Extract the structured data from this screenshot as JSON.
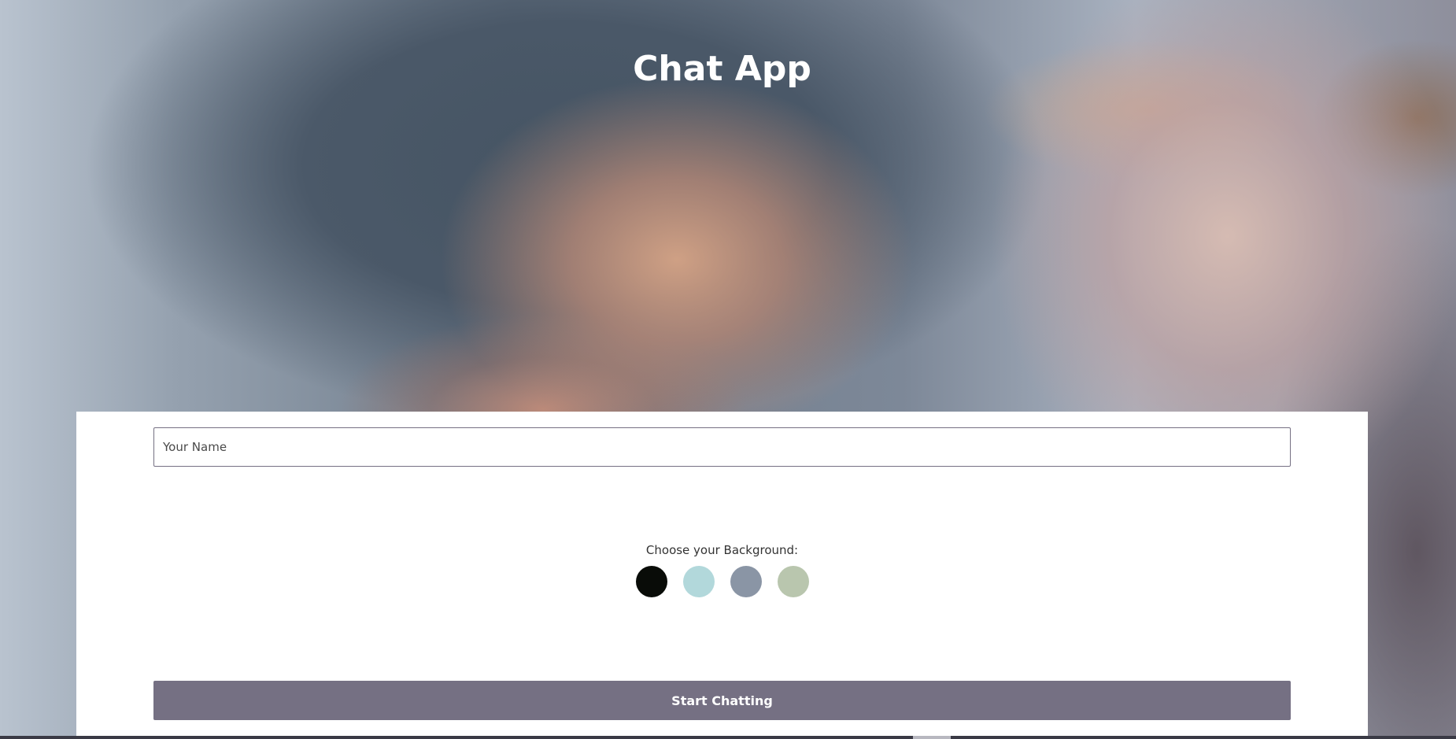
{
  "app": {
    "title": "Chat App"
  },
  "form": {
    "name_placeholder": "Your Name",
    "name_value": "",
    "background_label": "Choose your Background:",
    "background_options": [
      {
        "name": "black",
        "color": "#090C08"
      },
      {
        "name": "light-teal",
        "color": "#B2D8DB"
      },
      {
        "name": "slate-grey",
        "color": "#8A95A5"
      },
      {
        "name": "sage-green",
        "color": "#B9C6AE"
      }
    ],
    "start_button_label": "Start Chatting"
  },
  "colors": {
    "button_bg": "#757083",
    "card_bg": "#FFFFFF",
    "title_text": "#FFFFFF"
  }
}
